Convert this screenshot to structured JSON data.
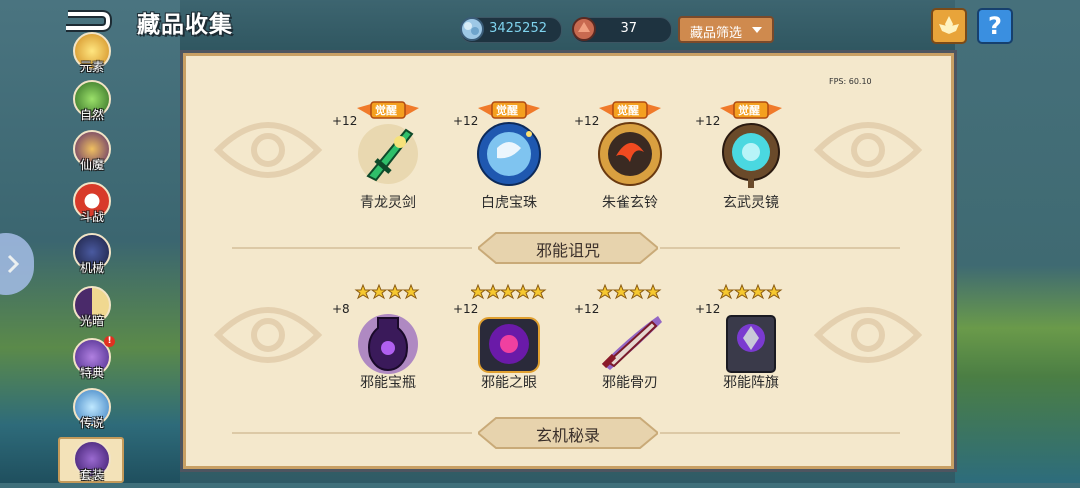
{
  "header": {
    "title": "藏品收集",
    "diamond_amount": "3425252",
    "ore_amount": "37",
    "filter_label": "藏品筛选",
    "help_label": "?"
  },
  "fps": "FPS: 60.10",
  "categories": [
    {
      "label": "元素"
    },
    {
      "label": "自然"
    },
    {
      "label": "仙魔"
    },
    {
      "label": "斗战"
    },
    {
      "label": "机械"
    },
    {
      "label": "光暗"
    },
    {
      "label": "特典"
    },
    {
      "label": "传说"
    },
    {
      "label": "套装"
    }
  ],
  "awaken_label": "觉醒",
  "section1": {
    "items": [
      {
        "name": "青龙灵剑",
        "level": "+12"
      },
      {
        "name": "白虎宝珠",
        "level": "+12"
      },
      {
        "name": "朱雀玄铃",
        "level": "+12"
      },
      {
        "name": "玄武灵镜",
        "level": "+12"
      }
    ]
  },
  "section2": {
    "title": "邪能诅咒",
    "items": [
      {
        "name": "邪能宝瓶",
        "level": "+8",
        "stars": 4
      },
      {
        "name": "邪能之眼",
        "level": "+12",
        "stars": 5
      },
      {
        "name": "邪能骨刃",
        "level": "+12",
        "stars": 4
      },
      {
        "name": "邪能阵旗",
        "level": "+12",
        "stars": 4
      }
    ]
  },
  "section3": {
    "title": "玄机秘录"
  },
  "colors": {
    "panel_bg": "#f4e8cc",
    "accent_orange": "#cf8a4e",
    "help_blue": "#3a8fe0",
    "diamond_text": "#7fd3ee"
  }
}
